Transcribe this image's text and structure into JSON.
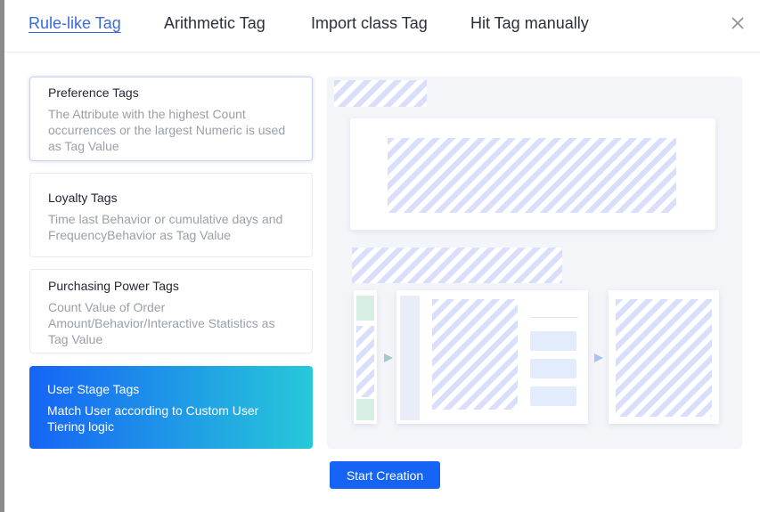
{
  "tabs": [
    {
      "label": "Rule-like Tag",
      "active": true
    },
    {
      "label": "Arithmetic Tag",
      "active": false
    },
    {
      "label": "Import class Tag",
      "active": false
    },
    {
      "label": "Hit Tag manually",
      "active": false
    }
  ],
  "close_icon": "close-icon",
  "cards": [
    {
      "title": "Preference Tags",
      "description": "The Attribute with the highest Count occurrences or the largest Numeric is used as Tag Value"
    },
    {
      "title": "Loyalty Tags",
      "description": "Time last Behavior or cumulative days and FrequencyBehavior as Tag Value"
    },
    {
      "title": "Purchasing Power Tags",
      "description": "Count Value of Order Amount/Behavior/Interactive Statistics as Tag Value"
    },
    {
      "title": "User Stage Tags",
      "description": "Match User according to Custom User Tiering logic"
    }
  ],
  "selected_card": "User Stage Tags",
  "colors": {
    "accent": "#1664f5",
    "gradient_end": "#27c9d9",
    "active_tab": "#3a6bd8"
  },
  "start_button": "Start Creation"
}
